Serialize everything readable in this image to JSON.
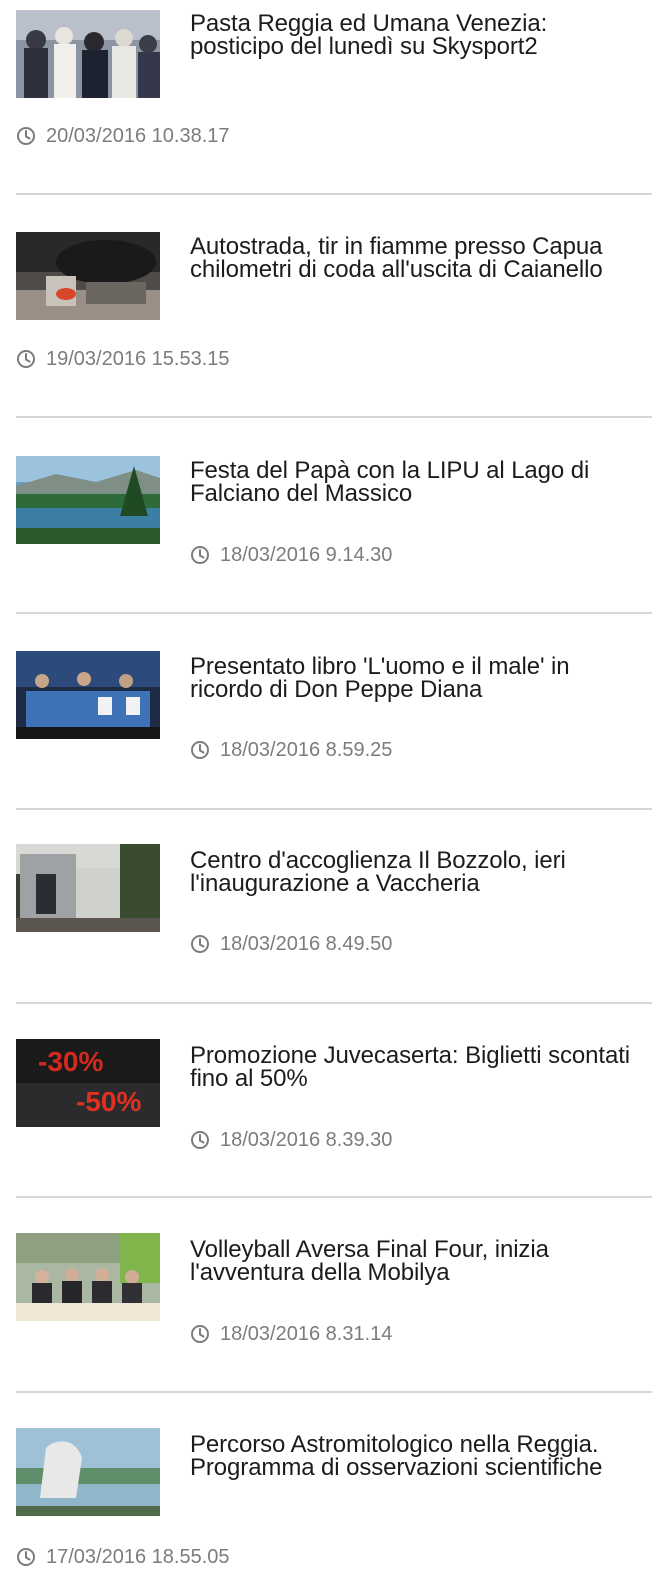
{
  "articles": [
    {
      "title": "Pasta Reggia ed Umana Venezia: posticipo del lunedì su Skysport2",
      "date": "20/03/2016 10.38.17",
      "thumb_icon": "photo-crowd-icon"
    },
    {
      "title": "Autostrada, tir in fiamme presso Capua chilometri di coda all'uscita di Caianello",
      "date": "19/03/2016 15.53.15",
      "thumb_icon": "photo-fire-icon"
    },
    {
      "title": "Festa del Papà con la LIPU al Lago di Falciano del Massico",
      "date": "18/03/2016 9.14.30",
      "thumb_icon": "photo-lake-icon"
    },
    {
      "title": "Presentato libro 'L'uomo e il male' in ricordo di Don Peppe Diana",
      "date": "18/03/2016 8.59.25",
      "thumb_icon": "photo-conference-icon"
    },
    {
      "title": "Centro d'accoglienza Il Bozzolo, ieri l'inaugurazione a Vaccheria",
      "date": "18/03/2016 8.49.50",
      "thumb_icon": "photo-building-icon"
    },
    {
      "title": "Promozione Juvecaserta: Biglietti scontati fino al 50%",
      "date": "18/03/2016 8.39.30",
      "thumb_icon": "photo-discount-icon",
      "thumb_text_1": "-30%",
      "thumb_text_2": "-50%"
    },
    {
      "title": "Volleyball Aversa Final Four, inizia l'avventura della Mobilya",
      "date": "18/03/2016 8.31.14",
      "thumb_icon": "photo-press-icon"
    },
    {
      "title": "Percorso Astromitologico nella Reggia. Programma di osservazioni scientifiche",
      "date": "17/03/2016 18.55.05",
      "thumb_icon": "photo-statue-icon"
    }
  ],
  "colors": {
    "text": "#1c1c1c",
    "meta": "#7c7c7c",
    "divider": "#d6d6d6",
    "discount_red": "#d42a1e"
  }
}
